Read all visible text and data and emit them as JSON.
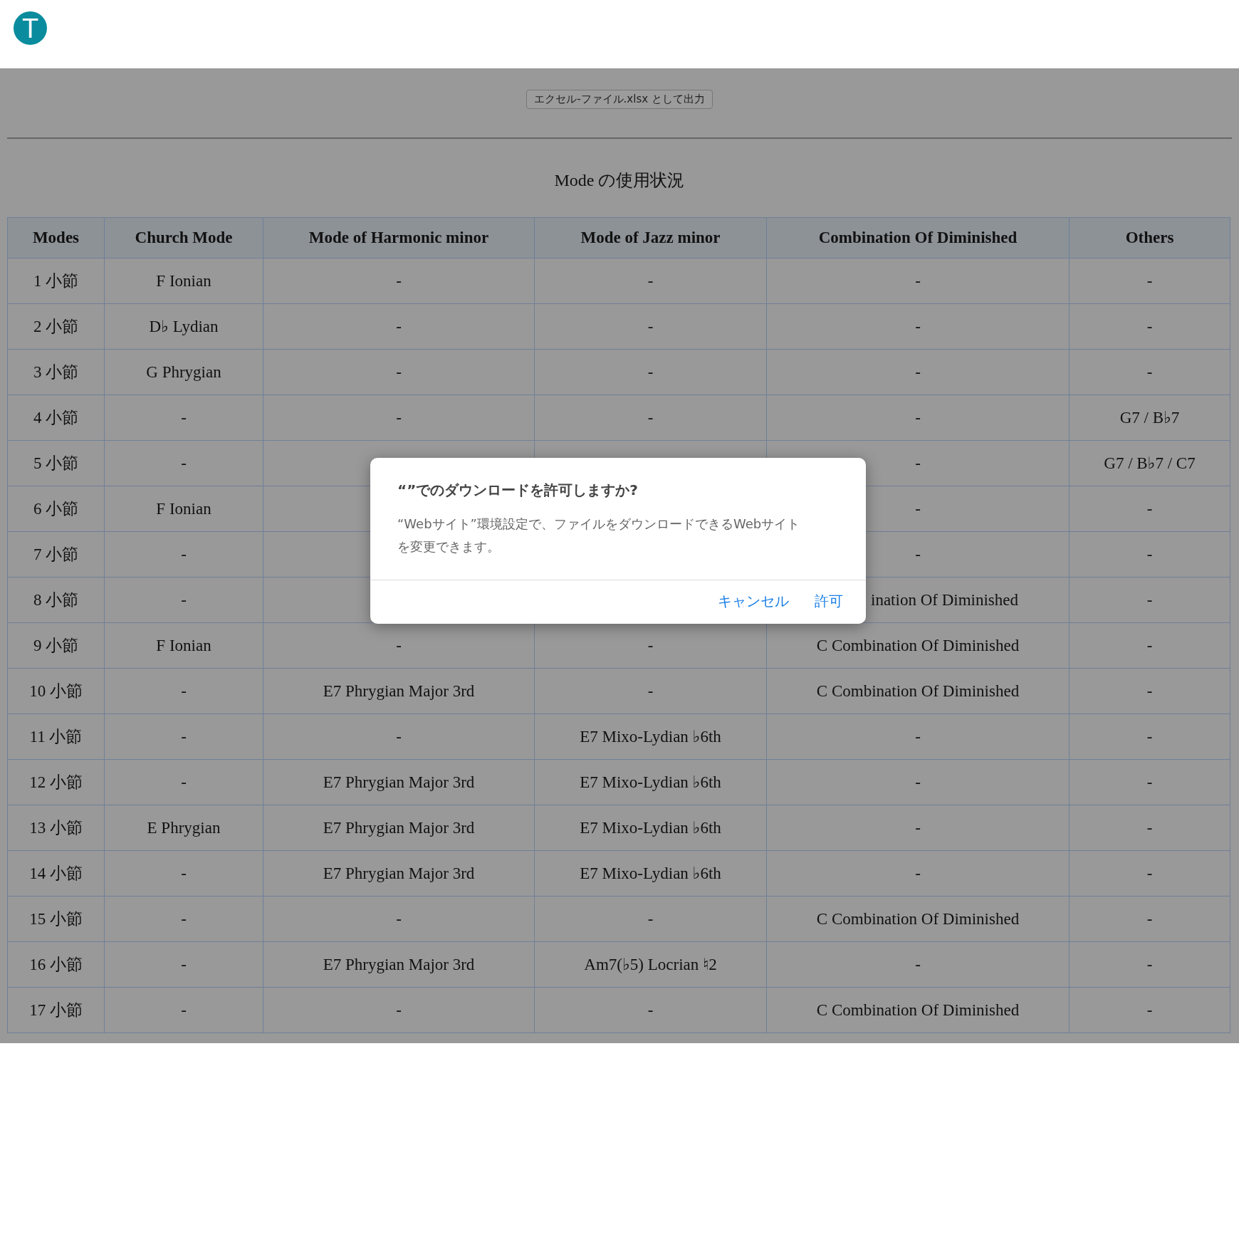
{
  "logo": {
    "letter": "T"
  },
  "export_button": "エクセル-ファイル.xlsx として出力",
  "table_title": "Mode の使用状況",
  "table": {
    "columns": [
      "Modes",
      "Church Mode",
      "Mode of Harmonic minor",
      "Mode of Jazz minor",
      "Combination Of Diminished",
      "Others"
    ],
    "rows": [
      [
        "1 小節",
        "F Ionian",
        "-",
        "-",
        "-",
        "-"
      ],
      [
        "2 小節",
        "D♭ Lydian",
        "-",
        "-",
        "-",
        "-"
      ],
      [
        "3 小節",
        "G Phrygian",
        "-",
        "-",
        "-",
        "-"
      ],
      [
        "4 小節",
        "-",
        "-",
        "-",
        "-",
        "G7 / B♭7"
      ],
      [
        "5 小節",
        "-",
        null,
        null,
        "-",
        "G7 / B♭7 / C7"
      ],
      [
        "6 小節",
        "F Ionian",
        null,
        null,
        "-",
        "-"
      ],
      [
        "7 小節",
        "-",
        null,
        null,
        "-",
        "-"
      ],
      [
        "8 小節",
        "-",
        null,
        null,
        {
          "text": "ination Of Diminished",
          "cut": true
        },
        "-"
      ],
      [
        "9 小節",
        "F Ionian",
        "-",
        "-",
        "C Combination Of Diminished",
        "-"
      ],
      [
        "10 小節",
        "-",
        "E7 Phrygian Major 3rd",
        "-",
        "C Combination Of Diminished",
        "-"
      ],
      [
        "11 小節",
        "-",
        "-",
        "E7 Mixo-Lydian ♭6th",
        "-",
        "-"
      ],
      [
        "12 小節",
        "-",
        "E7 Phrygian Major 3rd",
        "E7 Mixo-Lydian ♭6th",
        "-",
        "-"
      ],
      [
        "13 小節",
        "E Phrygian",
        "E7 Phrygian Major 3rd",
        "E7 Mixo-Lydian ♭6th",
        "-",
        "-"
      ],
      [
        "14 小節",
        "-",
        "E7 Phrygian Major 3rd",
        "E7 Mixo-Lydian ♭6th",
        "-",
        "-"
      ],
      [
        "15 小節",
        "-",
        "-",
        "-",
        "C Combination Of Diminished",
        "-"
      ],
      [
        "16 小節",
        "-",
        "E7 Phrygian Major 3rd",
        "Am7(♭5) Locrian ♮2",
        "-",
        "-"
      ],
      [
        "17 小節",
        "-",
        "-",
        "-",
        "C Combination Of Diminished",
        "-"
      ]
    ]
  },
  "dialog": {
    "title": "“”でのダウンロードを許可しますか?",
    "message": "“Webサイト”環境設定で、ファイルをダウンロードできるWebサイトを変更できます。",
    "buttons": [
      "キャンセル",
      "許可"
    ]
  }
}
